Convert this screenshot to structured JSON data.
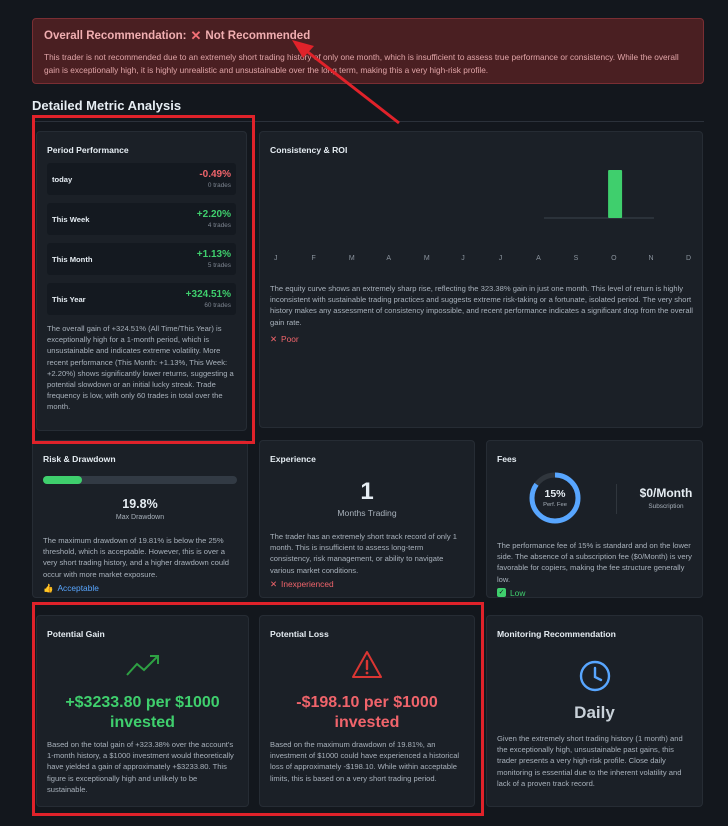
{
  "alert": {
    "title_prefix": "Overall Recommendation:",
    "title_status": "Not Recommended",
    "text": "This trader is not recommended due to an extremely short trading history of only one month, which is insufficient to assess true performance or consistency. While the overall gain is exceptionally high, it is highly unrealistic and unsustainable over the long term, making this a very high-risk profile."
  },
  "section_title": "Detailed Metric Analysis",
  "period": {
    "title": "Period Performance",
    "rows": [
      {
        "label": "today",
        "value": "-0.49%",
        "trades": "0 trades"
      },
      {
        "label": "This Week",
        "value": "+2.20%",
        "trades": "4 trades"
      },
      {
        "label": "This Month",
        "value": "+1.13%",
        "trades": "5 trades"
      },
      {
        "label": "This Year",
        "value": "+324.51%",
        "trades": "60 trades"
      }
    ],
    "description": "The overall gain of +324.51% (All Time/This Year) is exceptionally high for a 1-month period, which is unsustainable and indicates extreme volatility. More recent performance (This Month: +1.13%, This Week: +2.20%) shows significantly lower returns, suggesting a potential slowdown or an initial lucky streak. Trade frequency is low, with only 60 trades in total over the month."
  },
  "consistency": {
    "title": "Consistency & ROI",
    "months": [
      "J",
      "F",
      "M",
      "A",
      "M",
      "J",
      "J",
      "A",
      "S",
      "O",
      "N",
      "D"
    ],
    "description": "The equity curve shows an extremely sharp rise, reflecting the 323.38% gain in just one month. This level of return is highly inconsistent with sustainable trading practices and suggests extreme risk-taking or a fortunate, isolated period. The very short history makes any assessment of consistency impossible, and recent performance indicates a significant drop from the overall gain rate.",
    "verdict": "Poor"
  },
  "chart_data": {
    "type": "bar",
    "categories": [
      "J",
      "F",
      "M",
      "A",
      "M",
      "J",
      "J",
      "A",
      "S",
      "O",
      "N",
      "D"
    ],
    "values": [
      0,
      0,
      0,
      0,
      0,
      0,
      0,
      0,
      0,
      323.38,
      0,
      0
    ],
    "title": "",
    "xlabel": "",
    "ylabel": "",
    "ylim": [
      0,
      323.38
    ]
  },
  "risk": {
    "title": "Risk & Drawdown",
    "value": "19.8%",
    "label": "Max Drawdown",
    "progress": 0.198,
    "description": "The maximum drawdown of 19.81% is below the 25% threshold, which is acceptable. However, this is over a very short trading history, and a higher drawdown could occur with more market exposure.",
    "verdict": "Acceptable"
  },
  "experience": {
    "title": "Experience",
    "value": "1",
    "label": "Months Trading",
    "description": "The trader has an extremely short track record of only 1 month. This is insufficient to assess long-term consistency, risk management, or ability to navigate various market conditions.",
    "verdict": "Inexperienced"
  },
  "fees": {
    "title": "Fees",
    "perf_value": "15%",
    "perf_label": "Perf. Fee",
    "perf_fraction": 0.85,
    "sub_value": "$0/Month",
    "sub_label": "Subscription",
    "description": "The performance fee of 15% is standard and on the lower side. The absence of a subscription fee ($0/Month) is very favorable for copiers, making the fee structure generally low.",
    "verdict": "Low"
  },
  "gain": {
    "title": "Potential Gain",
    "value_line1": "+$3233.80 per $1000",
    "value_line2": "invested",
    "description": "Based on the total gain of +323.38% over the account's 1-month history, a $1000 investment would theoretically have yielded a gain of approximately +$3233.80. This figure is exceptionally high and unlikely to be sustainable."
  },
  "loss": {
    "title": "Potential Loss",
    "value_line1": "-$198.10 per $1000",
    "value_line2": "invested",
    "description": "Based on the maximum drawdown of 19.81%, an investment of $1000 could have experienced a historical loss of approximately -$198.10. While within acceptable limits, this is based on a very short trading period."
  },
  "monitoring": {
    "title": "Monitoring Recommendation",
    "value": "Daily",
    "description": "Given the extremely short trading history (1 month) and the exceptionally high, unsustainable past gains, this trader presents a very high-risk profile. Close daily monitoring is essential due to the inherent volatility and lack of a proven track record."
  },
  "colors": {
    "positive": "#3fcf6d",
    "negative": "#f0646b",
    "alert_bg": "#4a1f22",
    "highlight": "#e0222a"
  }
}
